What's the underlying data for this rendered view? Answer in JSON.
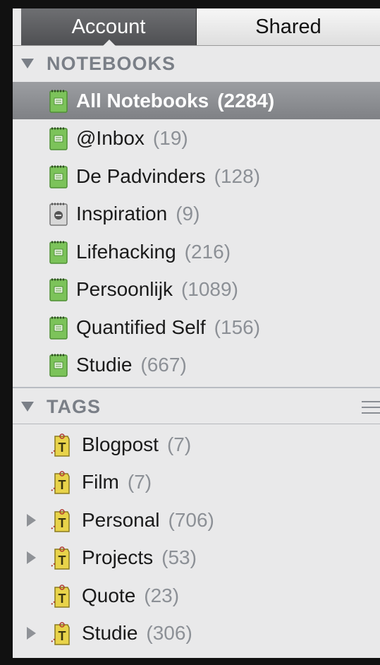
{
  "tabs": {
    "account": "Account",
    "shared": "Shared"
  },
  "notebooks": {
    "header": "NOTEBOOKS",
    "items": [
      {
        "name": "All Notebooks",
        "count": "(2284)",
        "selected": true,
        "icon": "notebook-stack-icon"
      },
      {
        "name": "@Inbox",
        "count": "(19)",
        "icon": "notebook-icon"
      },
      {
        "name": "De Padvinders",
        "count": "(128)",
        "icon": "notebook-icon"
      },
      {
        "name": "Inspiration",
        "count": "(9)",
        "icon": "shared-notebook-icon"
      },
      {
        "name": "Lifehacking",
        "count": "(216)",
        "icon": "notebook-icon"
      },
      {
        "name": "Persoonlijk",
        "count": "(1089)",
        "icon": "notebook-icon"
      },
      {
        "name": "Quantified Self",
        "count": "(156)",
        "icon": "notebook-icon"
      },
      {
        "name": "Studie",
        "count": "(667)",
        "icon": "notebook-icon"
      }
    ]
  },
  "tags": {
    "header": "TAGS",
    "items": [
      {
        "name": "Blogpost",
        "count": "(7)",
        "expandable": false
      },
      {
        "name": "Film",
        "count": "(7)",
        "expandable": false
      },
      {
        "name": "Personal",
        "count": "(706)",
        "expandable": true
      },
      {
        "name": "Projects",
        "count": "(53)",
        "expandable": true
      },
      {
        "name": "Quote",
        "count": "(23)",
        "expandable": false
      },
      {
        "name": "Studie",
        "count": "(306)",
        "expandable": true
      }
    ]
  },
  "colors": {
    "notebook_green": "#7cc35a",
    "tag_yellow": "#e8d34a",
    "selection": "#8a8c90",
    "count_gray": "#8c9096"
  }
}
